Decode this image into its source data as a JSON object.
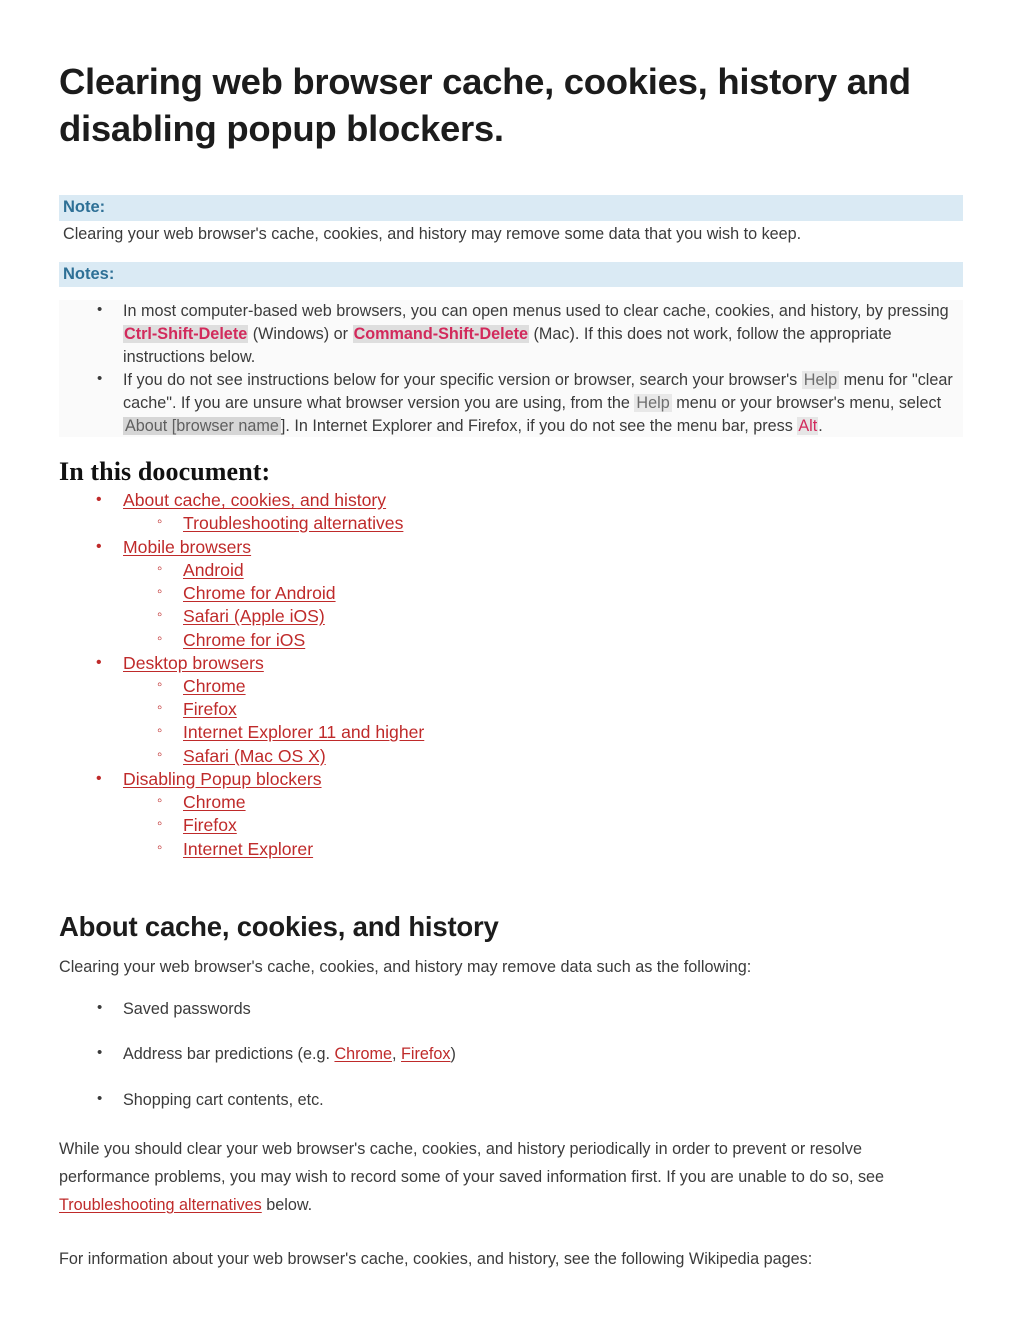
{
  "document": {
    "title": "Clearing web browser cache, cookies, history and disabling popup blockers."
  },
  "note": {
    "label": "Note:",
    "body": "Clearing your web browser's cache, cookies, and history may remove some data that you wish to keep."
  },
  "notes": {
    "label": "Notes:",
    "items": [
      {
        "seg1": "In most computer-based web browsers, you can open menus used to clear cache, cookies, and history, by pressing ",
        "key1": "Ctrl-Shift-Delete",
        "seg2": " (Windows) or ",
        "key2": "Command-Shift-Delete",
        "seg3": " (Mac). If this does not work, follow the appropriate instructions below."
      },
      {
        "seg1": "If you do not see instructions below for your specific version or browser, search your browser's ",
        "hl1": "Help",
        "seg2": " menu for \"clear cache\". If you are unsure what browser version you are using, from the ",
        "hl2": "Help",
        "seg3": " menu or your browser's menu, select ",
        "hl3": "About [browser name",
        "seg4": "]. In Internet Explorer and Firefox, if you do not see the menu bar, press ",
        "hl4": "Alt",
        "seg5": "."
      }
    ]
  },
  "toc": {
    "heading": "In this doocument:",
    "groups": [
      {
        "label": "About cache, cookies, and history",
        "children": [
          "Troubleshooting alternatives"
        ]
      },
      {
        "label": "Mobile browsers",
        "children": [
          "Android",
          "Chrome for Android",
          "Safari (Apple iOS)",
          "Chrome for iOS"
        ]
      },
      {
        "label": "Desktop browsers",
        "children": [
          "Chrome",
          "Firefox",
          "Internet Explorer 11 and higher",
          "Safari (Mac OS X)"
        ]
      },
      {
        "label": "Disabling Popup blockers",
        "children": [
          "Chrome",
          "Firefox",
          "Internet Explorer"
        ]
      }
    ]
  },
  "about_section": {
    "heading": "About cache, cookies, and history",
    "intro": "Clearing your web browser's cache, cookies, and history may remove data such as the following:",
    "items": [
      {
        "text": "Saved passwords"
      },
      {
        "prefix": "Address bar predictions (e.g. ",
        "link1": "Chrome",
        "mid": ", ",
        "link2": "Firefox",
        "suffix": ")"
      },
      {
        "text": "Shopping cart contents, etc."
      }
    ],
    "paragraph1_pre": "While you should clear your web browser's cache, cookies, and history periodically in order to prevent or resolve performance problems, you may wish to record some of your saved information first. If you are unable to do so, see ",
    "paragraph1_link": "Troubleshooting alternatives",
    "paragraph1_post": " below.",
    "paragraph2": "For information about your web browser's cache, cookies, and history, see the following Wikipedia pages:"
  },
  "colors": {
    "link_red": "#bf2a2a",
    "note_band": "#daeaf4",
    "note_label": "#2e7096",
    "key_pink": "#d22a5c",
    "key_bg": "#dedede",
    "menu_bg": "#e8e8e8",
    "body_text": "#3b3b3b"
  }
}
